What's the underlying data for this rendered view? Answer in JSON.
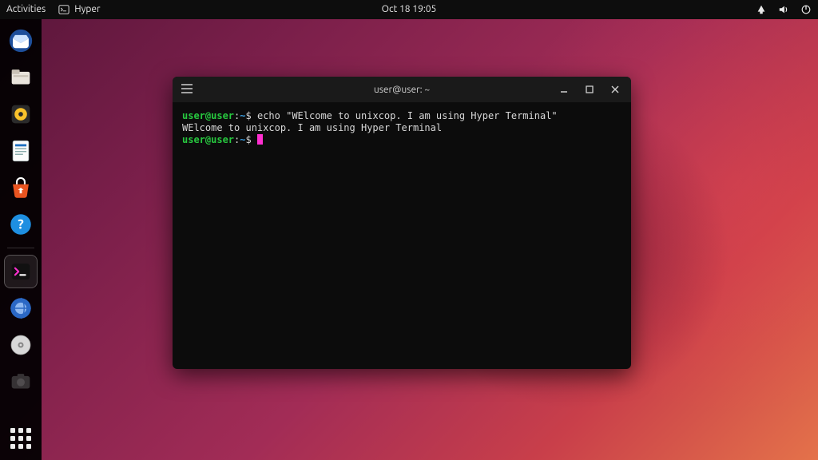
{
  "topbar": {
    "activities": "Activities",
    "app_name": "Hyper",
    "clock": "Oct 18  19:05"
  },
  "dock": {
    "items": [
      {
        "name": "thunderbird-icon"
      },
      {
        "name": "files-icon"
      },
      {
        "name": "rhythmbox-icon"
      },
      {
        "name": "libreoffice-writer-icon"
      },
      {
        "name": "software-store-icon"
      },
      {
        "name": "help-icon"
      },
      {
        "name": "hyper-terminal-icon"
      },
      {
        "name": "web-browser-icon"
      },
      {
        "name": "disc-utility-icon"
      },
      {
        "name": "screenshot-icon"
      }
    ],
    "active_index": 6
  },
  "terminal": {
    "title": "user@user: ~",
    "prompt_user": "user@user",
    "prompt_sep": ":",
    "prompt_path": "~",
    "prompt_symbol": "$",
    "command": "echo \"WElcome to unixcop. I am using Hyper Terminal\"",
    "output": "WElcome to unixcop. I am using Hyper Terminal"
  },
  "colors": {
    "prompt_user": "#27c93f",
    "prompt_path": "#3a9bdc",
    "cursor": "#ff2fd0"
  }
}
